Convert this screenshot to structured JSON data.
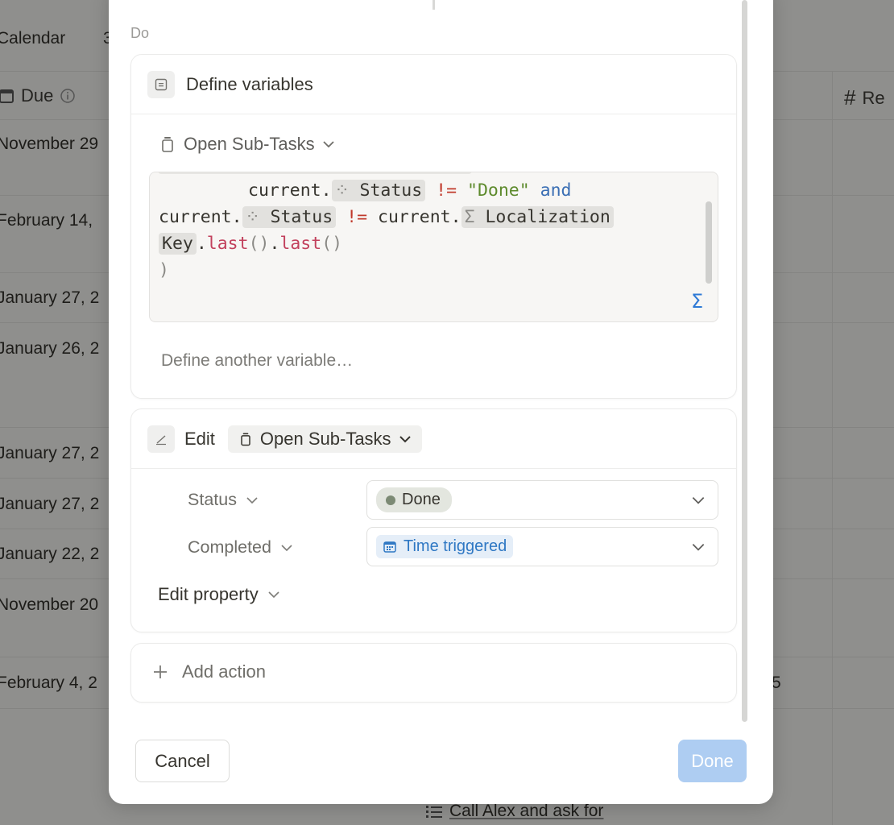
{
  "background": {
    "tab_label": "Calendar",
    "col_due": "Due",
    "col_hash": "#",
    "col_re": "Re",
    "dates": [
      "November 29",
      "February 14,",
      "January 27, 2",
      "January 26, 2",
      "January 27, 2",
      "January 27, 2",
      "January 22, 2",
      "November 20",
      "February 4, 2"
    ],
    "right_digit": "5",
    "bottom_task": "Call Alex and ask for"
  },
  "modal": {
    "section_label": "Do",
    "define_card": {
      "title": "Define variables",
      "variable_name": "Open Sub-Tasks",
      "code": {
        "l1_a": "current.",
        "l1_chip": "Status",
        "l1_op": "!=",
        "l1_str": "\"Done\"",
        "l1_kw": "and",
        "l2_a": "current.",
        "l2_chip": "Status",
        "l2_op": "!=",
        "l2_b": "current.",
        "l2_chip2": "Localization",
        "l3_chip": "Key",
        "l3_fn1": "last",
        "l3_fn2": "last",
        "l4": ")"
      },
      "define_another": "Define another variable…"
    },
    "edit_card": {
      "action_label": "Edit",
      "target": "Open Sub-Tasks",
      "properties": [
        {
          "label": "Status",
          "value": "Done"
        },
        {
          "label": "Completed",
          "value": "Time triggered"
        }
      ],
      "edit_property": "Edit property"
    },
    "add_action": "Add action",
    "cancel_label": "Cancel",
    "done_label": "Done"
  }
}
